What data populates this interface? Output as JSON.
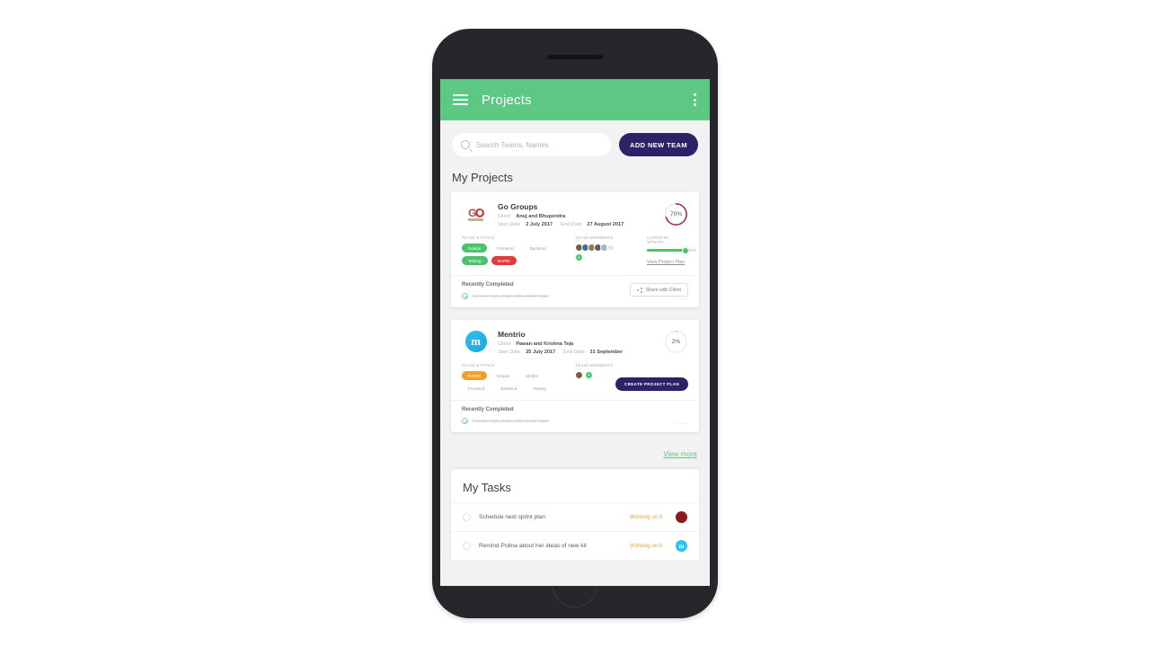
{
  "appbar": {
    "title": "Projects",
    "menu_icon": "hamburger-icon",
    "overflow_icon": "kebab-menu-icon"
  },
  "search": {
    "placeholder": "Search Teams, Names",
    "value": "",
    "icon": "search-icon"
  },
  "actions": {
    "add_team_label": "ADD NEW TEAM"
  },
  "projects_section": {
    "title": "My Projects",
    "view_more_label": "View more"
  },
  "projects": [
    {
      "name": "Go Groups",
      "logo_text": "GO",
      "client_label": "Client",
      "client": "Anuj and Bhupendra",
      "start_label": "Start Date",
      "start_date": "2 July 2017",
      "end_label": "End Date",
      "end_date": "27 August 2017",
      "progress": "70%",
      "progress_value": 70,
      "progress_color": "#9e2b3a",
      "team_status_label": "TEAM STATUS",
      "status_chips": [
        {
          "label": "Design",
          "style": "green"
        },
        {
          "label": "Frontend",
          "style": "plain"
        },
        {
          "label": "Backend",
          "style": "plain"
        },
        {
          "label": "Testing",
          "style": "green"
        },
        {
          "label": "RAPID",
          "style": "red"
        }
      ],
      "team_members_label": "TEAM MEMBERS",
      "member_count": 6,
      "member_overflow": "+6",
      "current_sprint_label": "CURRENT SPRINT",
      "sprint_value": 85,
      "view_plan_label": "View Project Plan",
      "recent_label": "Recently Completed",
      "recent_task": "Create login page with social login",
      "share_label": "Share with Client",
      "share_icon": "share-icon",
      "overflow_dots": "• • •"
    },
    {
      "name": "Mentrio",
      "logo_text": "m",
      "client_label": "Client",
      "client": "Pawan and Krishna Teja",
      "start_label": "Start Date",
      "start_date": "25 July 2017",
      "end_label": "End Date",
      "end_date": "31 September",
      "progress": "2%",
      "progress_value": 2,
      "progress_color": "#d8d8d8",
      "team_status_label": "TEAM STATUS",
      "status_chips": [
        {
          "label": "RAPID",
          "style": "orange"
        },
        {
          "label": "Design",
          "style": "plain"
        },
        {
          "label": "Mobile",
          "style": "plain"
        },
        {
          "label": "Frontend",
          "style": "plain"
        },
        {
          "label": "Backend",
          "style": "plain"
        },
        {
          "label": "Testing",
          "style": "plain"
        }
      ],
      "team_members_label": "TEAM MEMBERS",
      "member_count": 1,
      "create_plan_label": "CREATE PROJECT PLAN",
      "recent_label": "Recently Completed",
      "recent_task": "Create login page with social login",
      "overflow_dots": "• • •"
    }
  ],
  "tasks_section": {
    "title": "My Tasks",
    "items": [
      {
        "label": "Schedule next sprint plan",
        "status": "Working on it",
        "avatar": "red",
        "avatar_text": ""
      },
      {
        "label": "Remind Polina about her ideas of new kit",
        "status": "Working on it",
        "avatar": "blue",
        "avatar_text": "m"
      }
    ]
  },
  "theme": {
    "accent_green": "#5dc883",
    "accent_navy": "#2b2268",
    "status_orange": "#e8a33d"
  }
}
